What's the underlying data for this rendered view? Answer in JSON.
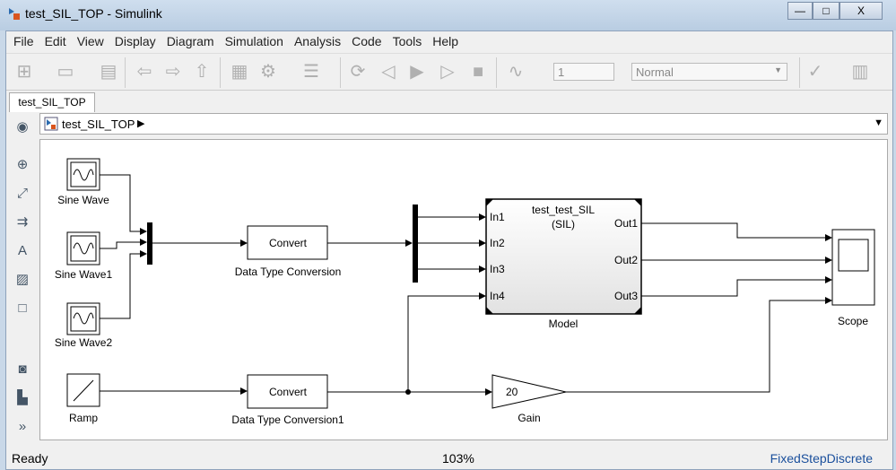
{
  "window": {
    "title": "test_SIL_TOP - Simulink",
    "minimize": "—",
    "maximize": "□",
    "close": "X"
  },
  "menu": [
    "File",
    "Edit",
    "View",
    "Display",
    "Diagram",
    "Simulation",
    "Analysis",
    "Code",
    "Tools",
    "Help"
  ],
  "toolbar": {
    "stop_time": "1",
    "sim_mode": "Normal"
  },
  "tab": "test_SIL_TOP",
  "breadcrumb": {
    "model": "test_SIL_TOP"
  },
  "diagram": {
    "sine_wave": "Sine Wave",
    "sine_wave1": "Sine Wave1",
    "sine_wave2": "Sine Wave2",
    "ramp": "Ramp",
    "convert_text": "Convert",
    "convert1_text": "Convert",
    "dtc": "Data Type Conversion",
    "dtc1": "Data Type Conversion1",
    "model_name": "test_test_SIL",
    "model_mode": "(SIL)",
    "model_label": "Model",
    "inports": [
      "In1",
      "In2",
      "In3",
      "In4"
    ],
    "outports": [
      "Out1",
      "Out2",
      "Out3"
    ],
    "gain_value": "20",
    "gain_label": "Gain",
    "scope_label": "Scope"
  },
  "status": {
    "left": "Ready",
    "zoom": "103%",
    "solver": "FixedStepDiscrete"
  }
}
